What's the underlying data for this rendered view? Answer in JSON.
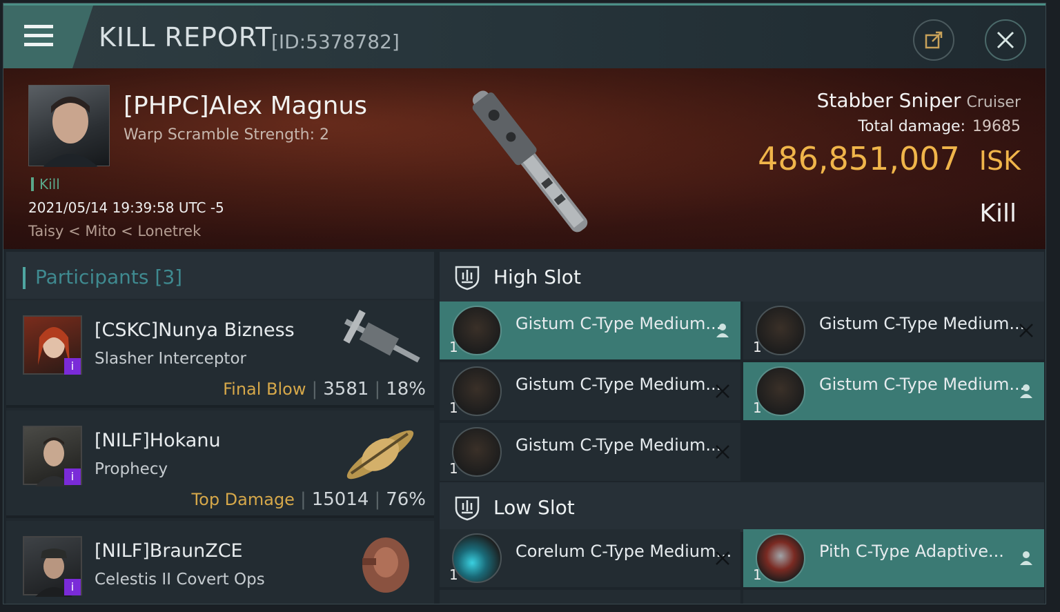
{
  "header": {
    "title": "KILL REPORT",
    "id_text": "[ID:5378782]"
  },
  "victim": {
    "name": "[PHPC]Alex Magnus",
    "warp_scramble": "Warp Scramble Strength: 2",
    "tag": "Kill",
    "datetime": "2021/05/14 19:39:58 UTC -5",
    "location": "Taisy < Mito < Lonetrek",
    "ship_name": "Stabber Sniper",
    "ship_class": "Cruiser",
    "total_damage_label": "Total damage:",
    "total_damage": "19685",
    "isk_value": "486,851,007",
    "isk_unit": "ISK",
    "result": "Kill"
  },
  "participants": {
    "label": "Participants",
    "count": "[3]",
    "list": [
      {
        "name": "[CSKC]Nunya Bizness",
        "ship": "Slasher Interceptor",
        "role": "Final Blow",
        "damage": "3581",
        "percent": "18%"
      },
      {
        "name": "[NILF]Hokanu",
        "ship": "Prophecy",
        "role": "Top Damage",
        "damage": "15014",
        "percent": "76%"
      },
      {
        "name": "[NILF]BraunZCE",
        "ship": "Celestis II Covert Ops",
        "role": "",
        "damage": "",
        "percent": ""
      }
    ]
  },
  "high_slot": {
    "label": "High Slot",
    "items": [
      {
        "name": "Gistum C-Type Medium...",
        "qty": "1",
        "state": "person-icon"
      },
      {
        "name": "Gistum C-Type Medium...",
        "qty": "1",
        "state": "x-icon"
      },
      {
        "name": "Gistum C-Type Medium...",
        "qty": "1",
        "state": "x-icon"
      },
      {
        "name": "Gistum C-Type Medium...",
        "qty": "1",
        "state": "person-icon"
      },
      {
        "name": "Gistum C-Type Medium...",
        "qty": "1",
        "state": "x-icon"
      }
    ]
  },
  "low_slot": {
    "label": "Low Slot",
    "items": [
      {
        "name": "Corelum C-Type Medium...",
        "qty": "1",
        "state": "x-icon"
      },
      {
        "name": "Pith C-Type Adaptive...",
        "qty": "1",
        "state": "person-icon"
      }
    ]
  },
  "colors": {
    "accent_teal": "#3b7a74",
    "isk_gold": "#f0b54a",
    "final_blow": "#d6a84a",
    "badge_purple": "#7a2bd8"
  }
}
